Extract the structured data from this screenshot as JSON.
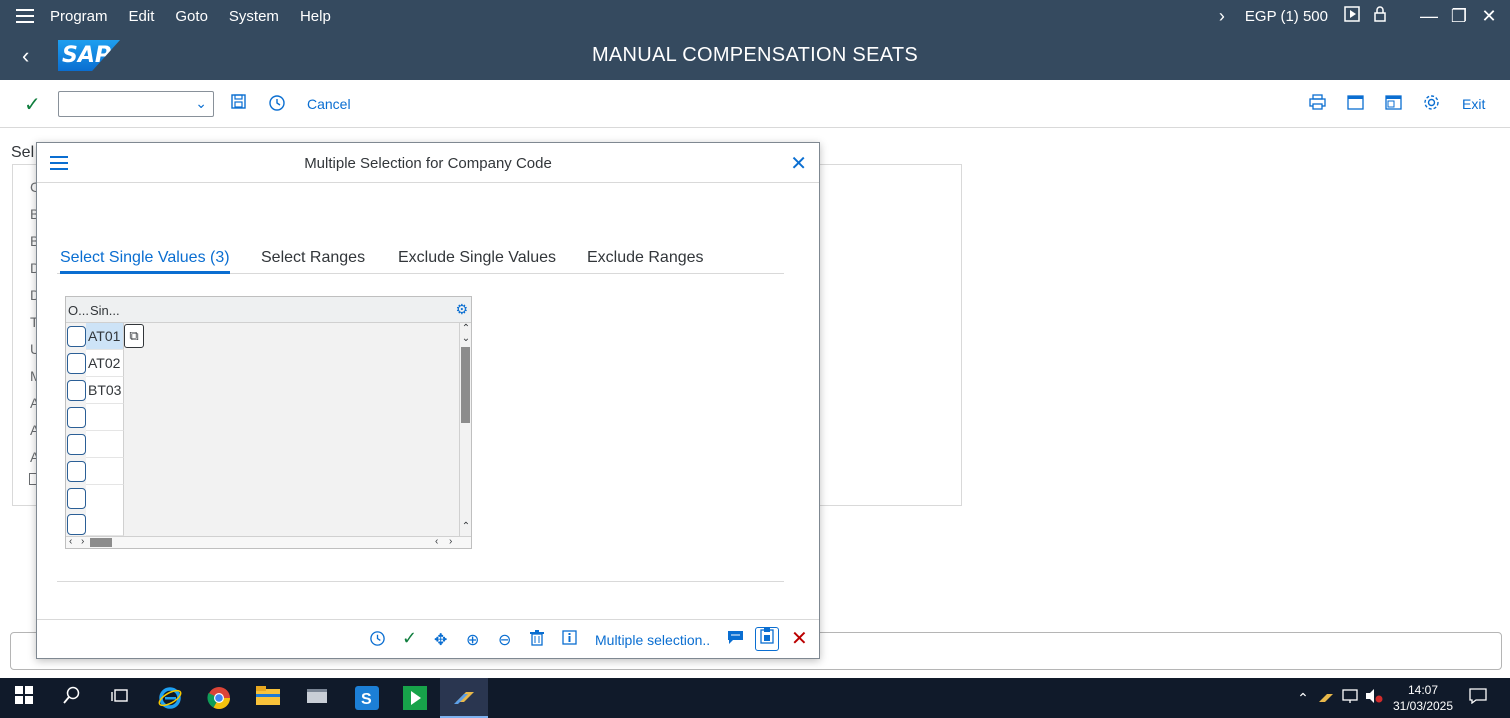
{
  "menubar": {
    "items": [
      "Program",
      "Edit",
      "Goto",
      "System",
      "Help"
    ],
    "system_info": "EGP (1) 500"
  },
  "header": {
    "logo_text": "SAP",
    "title": "MANUAL COMPENSATION SEATS"
  },
  "toolbar": {
    "cancel_label": "Cancel",
    "exit_label": "Exit"
  },
  "background": {
    "selection_label": "Sel",
    "field_initials": [
      "C",
      "B",
      "B",
      "D",
      "D",
      "T",
      "U",
      "M",
      "A",
      "A",
      "A"
    ]
  },
  "dialog": {
    "title": "Multiple Selection for Company Code",
    "tabs": [
      {
        "label": "Select Single Values (3)",
        "active": true
      },
      {
        "label": "Select Ranges",
        "active": false
      },
      {
        "label": "Exclude Single Values",
        "active": false
      },
      {
        "label": "Exclude Ranges",
        "active": false
      }
    ],
    "grid": {
      "col_option": "O...",
      "col_single": "Sin...",
      "rows": [
        "AT01",
        "AT02",
        "BT03",
        "",
        "",
        "",
        "",
        ""
      ]
    },
    "footer": {
      "multiple_selection_label": "Multiple selection.."
    }
  },
  "taskbar": {
    "time": "14:07",
    "date": "31/03/2025"
  },
  "colors": {
    "shell": "#354a5f",
    "accent": "#0a6ed1",
    "positive": "#107e3e",
    "negative": "#bb0000"
  }
}
